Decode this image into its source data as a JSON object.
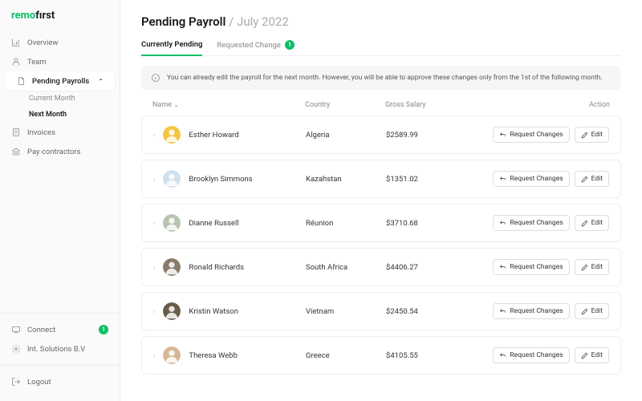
{
  "brand": {
    "part1": "remo",
    "part2": "fırst"
  },
  "nav": {
    "overview": "Overview",
    "team": "Team",
    "pending": "Pending Payrolls",
    "current": "Current Month",
    "next": "Next Month",
    "invoices": "Invoices",
    "pay": "Pay contractors",
    "connect": "Connect",
    "connect_badge": "1",
    "company": "Int. Solutions B.V",
    "logout": "Logout"
  },
  "header": {
    "title": "Pending Payroll",
    "sep": "/",
    "period": "July 2022"
  },
  "tabs": {
    "pending": "Currently Pending",
    "requested": "Requested Change",
    "req_badge": "1"
  },
  "notice": "You can already edit the payroll for the next month. However, you will be able to approve these changes only from the 1st of the following month.",
  "cols": {
    "name": "Name",
    "country": "Country",
    "salary": "Gross Salary",
    "action": "Action"
  },
  "buttons": {
    "request": "Request Changes",
    "edit": "Edit"
  },
  "rows": [
    {
      "name": "Esther Howard",
      "country": "Algeria",
      "salary": "$2589.99",
      "av": "#f5c542"
    },
    {
      "name": "Brooklyn Simmons",
      "country": "Kazahstan",
      "salary": "$1351.02",
      "av": "#cfe0ef"
    },
    {
      "name": "Dianne Russell",
      "country": "Réunion",
      "salary": "$3710.68",
      "av": "#b8c4b0"
    },
    {
      "name": "Ronald Richards",
      "country": "South Africa",
      "salary": "$4406.27",
      "av": "#8a7a6a"
    },
    {
      "name": "Kristin Watson",
      "country": "Vietnam",
      "salary": "$2450.54",
      "av": "#6b5b4a"
    },
    {
      "name": "Theresa Webb",
      "country": "Greece",
      "salary": "$4105.55",
      "av": "#d4b896"
    }
  ]
}
